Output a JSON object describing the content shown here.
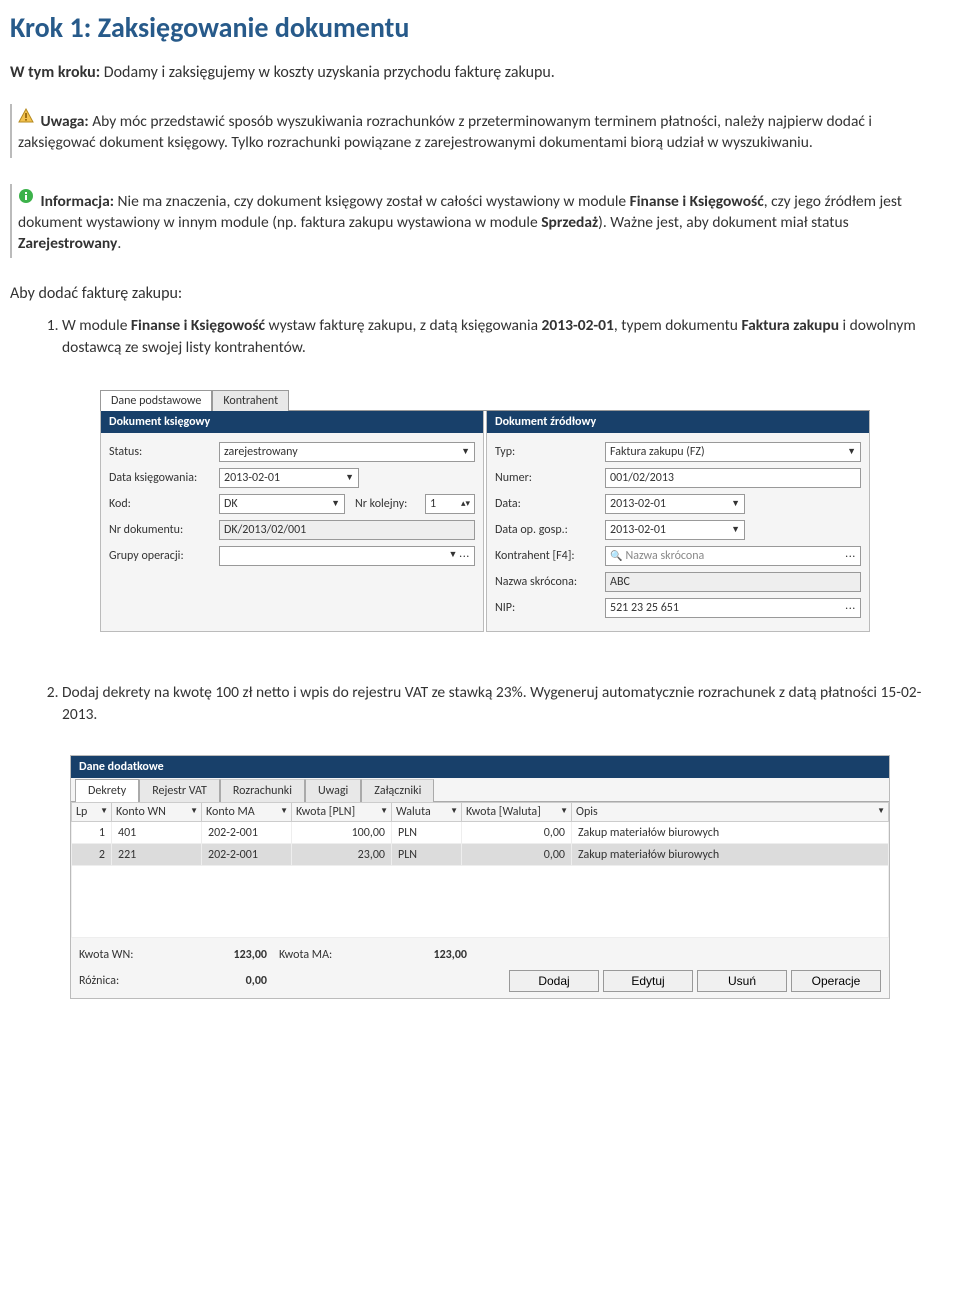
{
  "title": "Krok 1: Zaksięgowanie dokumentu",
  "intro": {
    "prefix": "W tym kroku:",
    "text": " Dodamy i zaksięgujemy w koszty uzyskania przychodu fakturę zakupu."
  },
  "warning": {
    "label": "Uwaga:",
    "text": " Aby móc przedstawić sposób wyszukiwania rozrachunków z przeterminowanym terminem płatności, należy najpierw dodać i zaksięgować dokument księgowy. Tylko rozrachunki powiązane z zarejestrowanymi dokumentami biorą udział w wyszukiwaniu."
  },
  "info": {
    "label": "Informacja:",
    "text1": " Nie ma znaczenia, czy dokument księgowy został w całości wystawiony w module ",
    "b1": "Finanse i Księgowość",
    "text2": ", czy jego źródłem jest dokument wystawiony w innym module (np. faktura zakupu wystawiona w module ",
    "b2": "Sprzedaż",
    "text3": "). Ważne jest, aby dokument miał status ",
    "b3": "Zarejestrowany",
    "text4": "."
  },
  "subhead": "Aby dodać fakturę zakupu:",
  "step1": {
    "pre": "W module ",
    "b1": "Finanse i Księgowość",
    "mid": " wystaw fakturę zakupu, z datą księgowania ",
    "b2": "2013-02-01",
    "mid2": ", typem dokumentu ",
    "b3": "Faktura zakupu",
    "end": " i dowolnym dostawcą ze swojej listy kontrahentów."
  },
  "step2": "Dodaj dekrety na kwotę 100 zł netto i wpis do rejestru VAT ze stawką 23%. Wygeneruj automatycznie rozrachunek z datą płatności 15-02-2013.",
  "form": {
    "tabs": [
      "Dane podstawowe",
      "Kontrahent"
    ],
    "left": {
      "title": "Dokument księgowy",
      "status_lbl": "Status:",
      "status_val": "zarejestrowany",
      "data_ks_lbl": "Data księgowania:",
      "data_ks_val": "2013-02-01",
      "kod_lbl": "Kod:",
      "kod_val": "DK",
      "nrkol_lbl": "Nr kolejny:",
      "nrkol_val": "1",
      "nrdok_lbl": "Nr dokumentu:",
      "nrdok_val": "DK/2013/02/001",
      "grupy_lbl": "Grupy operacji:"
    },
    "right": {
      "title": "Dokument źródłowy",
      "typ_lbl": "Typ:",
      "typ_val": "Faktura zakupu (FZ)",
      "numer_lbl": "Numer:",
      "numer_val": "001/02/2013",
      "data_lbl": "Data:",
      "data_val": "2013-02-01",
      "dataop_lbl": "Data op. gosp.:",
      "dataop_val": "2013-02-01",
      "kontr_lbl": "Kontrahent [F4]:",
      "kontr_ph": "Nazwa skrócona",
      "nazwa_lbl": "Nazwa skrócona:",
      "nazwa_val": "ABC",
      "nip_lbl": "NIP:",
      "nip_val": "521 23 25 651"
    }
  },
  "grid": {
    "title": "Dane dodatkowe",
    "tabs": [
      "Dekrety",
      "Rejestr VAT",
      "Rozrachunki",
      "Uwagi",
      "Załączniki"
    ],
    "cols": [
      "Lp",
      "Konto WN",
      "Konto MA",
      "Kwota [PLN]",
      "Waluta",
      "Kwota [Waluta]",
      "Opis"
    ],
    "rows": [
      {
        "lp": "1",
        "wn": "401",
        "ma": "202-2-001",
        "kwota": "100,00",
        "wal": "PLN",
        "kwotaw": "0,00",
        "opis": "Zakup materiałów biurowych"
      },
      {
        "lp": "2",
        "wn": "221",
        "ma": "202-2-001",
        "kwota": "23,00",
        "wal": "PLN",
        "kwotaw": "0,00",
        "opis": "Zakup materiałów biurowych"
      }
    ],
    "footer": {
      "kwn_lbl": "Kwota WN:",
      "kwn": "123,00",
      "kma_lbl": "Kwota MA:",
      "kma": "123,00",
      "roz_lbl": "Różnica:",
      "roz": "0,00",
      "btn_add": "Dodaj",
      "btn_edit": "Edytuj",
      "btn_del": "Usuń",
      "btn_ops": "Operacje"
    }
  }
}
